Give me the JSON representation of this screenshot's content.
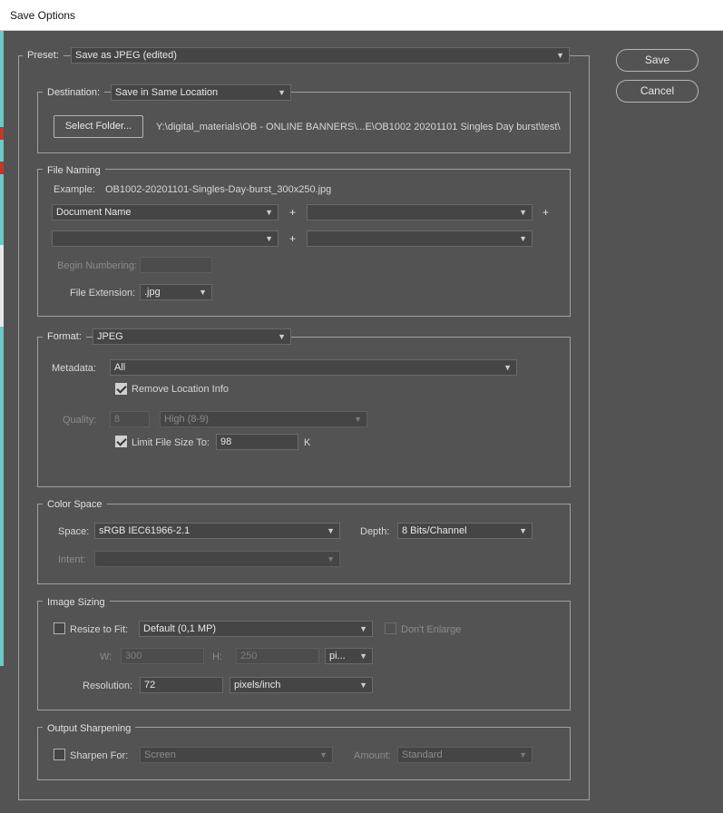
{
  "window": {
    "title": "Save Options"
  },
  "buttons": {
    "save": "Save",
    "cancel": "Cancel"
  },
  "preset": {
    "label": "Preset:",
    "value": "Save as JPEG (edited)"
  },
  "destination": {
    "label": "Destination:",
    "value": "Save in Same Location",
    "select_folder": "Select Folder...",
    "path": "Y:\\digital_materials\\OB - ONLINE BANNERS\\...E\\OB1002 20201101 Singles Day burst\\test\\"
  },
  "file_naming": {
    "legend": "File Naming",
    "example_label": "Example:",
    "example_value": "OB1002-20201101-Singles-Day-burst_300x250.jpg",
    "field1": "Document Name",
    "field2": "",
    "field3": "",
    "field4": "",
    "plus": "+",
    "begin_numbering_label": "Begin Numbering:",
    "begin_numbering_value": "",
    "extension_label": "File Extension:",
    "extension_value": ".jpg"
  },
  "format": {
    "label": "Format:",
    "value": "JPEG",
    "metadata_label": "Metadata:",
    "metadata_value": "All",
    "remove_location_label": "Remove Location Info",
    "remove_location_checked": true,
    "quality_label": "Quality:",
    "quality_value": "8",
    "quality_preset": "High  (8-9)",
    "limit_label": "Limit File Size To:",
    "limit_checked": true,
    "limit_value": "98",
    "limit_unit": "K"
  },
  "color_space": {
    "legend": "Color Space",
    "space_label": "Space:",
    "space_value": "sRGB IEC61966-2.1",
    "depth_label": "Depth:",
    "depth_value": "8 Bits/Channel",
    "intent_label": "Intent:",
    "intent_value": ""
  },
  "image_sizing": {
    "legend": "Image Sizing",
    "resize_label": "Resize to Fit:",
    "resize_checked": false,
    "resize_value": "Default  (0,1 MP)",
    "dont_enlarge_label": "Don't Enlarge",
    "w_label": "W:",
    "w_value": "300",
    "h_label": "H:",
    "h_value": "250",
    "unit_value": "pi...",
    "resolution_label": "Resolution:",
    "resolution_value": "72",
    "resolution_unit": "pixels/inch"
  },
  "output_sharpening": {
    "legend": "Output Sharpening",
    "sharpen_label": "Sharpen For:",
    "sharpen_checked": false,
    "sharpen_value": "Screen",
    "amount_label": "Amount:",
    "amount_value": "Standard"
  },
  "colors": {
    "dialog_bg": "#535353",
    "field_bg": "#454545",
    "border": "#a0a0a0",
    "accent_strip": "#6cc9c3"
  },
  "icons": {
    "dropdown": "chevron-down-icon",
    "checkbox": "checkmark-icon"
  }
}
